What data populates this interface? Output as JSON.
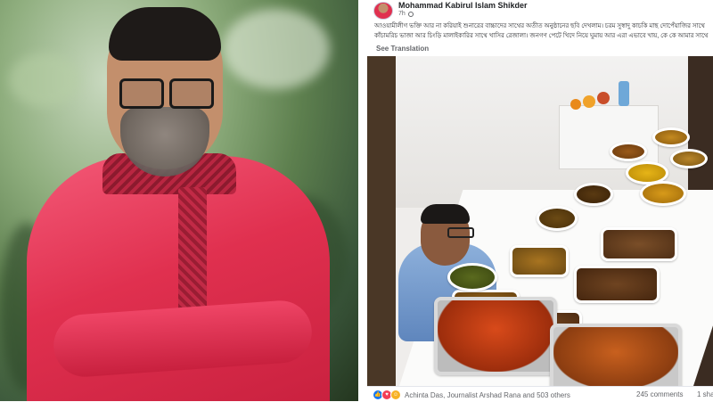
{
  "post": {
    "author": "Mohammad Kabirul Islam Shikder",
    "time": "7h",
    "text": "আওয়ামীলীগ ভক্তি আর না করিয়াই শুনারের বাচ্চাদের সাথের অতীত অনুষ্ঠানের ছবি দেখলাম। চরম সুস্বাদু কাচকি মাছ দোপেঁয়াজির সাথে কাঁচামরিচ ভাজা আর চিংড়ি মালাইকারির সাথে খাসির রেজালা। জনগণ পেটে খিদে নিয়ে ঘুমায় আর এরা এভাবে খায়, কে কে আমার সাথে থাকবেন?",
    "see_translation": "See Translation",
    "reactors": "Achinta Das, Journalist Arshad Rana and 503 others",
    "comments": "245 comments",
    "shares": "1 sha"
  },
  "icons": {
    "like": "like-icon",
    "love": "love-icon",
    "haha": "haha-icon",
    "globe": "globe-icon"
  },
  "colors": {
    "shirt": "#e0304f",
    "facebook_blue": "#1877f2",
    "meta_gray": "#65676b"
  }
}
